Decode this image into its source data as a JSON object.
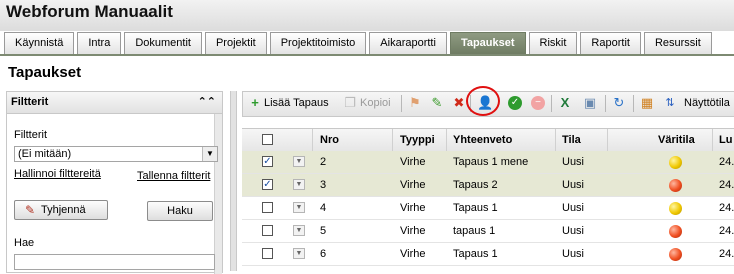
{
  "app": {
    "title": "Webforum Manuaalit"
  },
  "tabs": [
    {
      "label": "Käynnistä"
    },
    {
      "label": "Intra"
    },
    {
      "label": "Dokumentit"
    },
    {
      "label": "Projektit"
    },
    {
      "label": "Projektitoimisto"
    },
    {
      "label": "Aikaraportti"
    },
    {
      "label": "Tapaukset",
      "active": true
    },
    {
      "label": "Riskit"
    },
    {
      "label": "Raportit"
    },
    {
      "label": "Resurssit"
    }
  ],
  "page": {
    "title": "Tapaukset"
  },
  "filter": {
    "header": "Filtterit",
    "collapse_icon": "double-chevron-up-icon",
    "filter_label": "Filtterit",
    "selected": "(Ei mitään)",
    "manage_link": "Hallinnoi filttereitä",
    "save_link": "Tallenna filtterit",
    "clear_button": "Tyhjennä",
    "search_button": "Haku",
    "search_label": "Hae"
  },
  "toolbar": {
    "add_label": "Lisää Tapaus",
    "copy_label": "Kopioi",
    "view_label": "Näyttötila"
  },
  "grid": {
    "columns": [
      "Nro",
      "Tyyppi",
      "Yhteenveto",
      "Tila",
      "Väritila",
      "Lu"
    ],
    "rows": [
      {
        "nro": "2",
        "tyyppi": "Virhe",
        "yhteenveto": "Tapaus 1 mene",
        "tila": "Uusi",
        "color": "yellow",
        "lu": "24.",
        "checked": true
      },
      {
        "nro": "3",
        "tyyppi": "Virhe",
        "yhteenveto": "Tapaus 2",
        "tila": "Uusi",
        "color": "red",
        "lu": "24.",
        "checked": true
      },
      {
        "nro": "4",
        "tyyppi": "Virhe",
        "yhteenveto": "Tapaus 1",
        "tila": "Uusi",
        "color": "yellow",
        "lu": "24.",
        "checked": false
      },
      {
        "nro": "5",
        "tyyppi": "Virhe",
        "yhteenveto": "tapaus 1",
        "tila": "Uusi",
        "color": "red",
        "lu": "24.",
        "checked": false
      },
      {
        "nro": "6",
        "tyyppi": "Virhe",
        "yhteenveto": "Tapaus 1",
        "tila": "Uusi",
        "color": "red",
        "lu": "24.",
        "checked": false
      }
    ]
  },
  "colors": {
    "active_tab": "#7d8a72",
    "selected_row": "#e6e8d4",
    "highlight": "#e01010"
  }
}
